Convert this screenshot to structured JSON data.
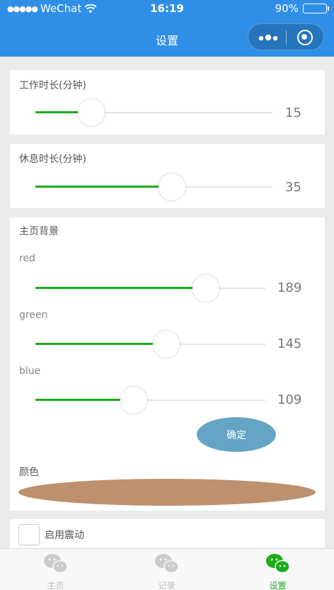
{
  "status_bar": {
    "carrier": "WeChat",
    "signal_dots": "●●●●●",
    "time": "16:19",
    "battery": "90%"
  },
  "nav": {
    "title": "设置"
  },
  "work": {
    "label": "工作时长(分钟)",
    "value": 15,
    "min": 1,
    "max": 60
  },
  "rest": {
    "label": "休息时长(分钟)",
    "value": 35,
    "min": 1,
    "max": 60
  },
  "background": {
    "label": "主页背景",
    "red": {
      "label": "red",
      "value": 189,
      "min": 0,
      "max": 255
    },
    "green": {
      "label": "green",
      "value": 145,
      "min": 0,
      "max": 255
    },
    "blue": {
      "label": "blue",
      "value": 109,
      "min": 0,
      "max": 255
    },
    "confirm_label": "确定",
    "color_label": "颜色",
    "swatch_color": "#bd916d"
  },
  "vibration": {
    "label": "启用震动",
    "checked": false
  },
  "tabs": [
    {
      "label": "主页",
      "icon": "wechat-icon",
      "active": false
    },
    {
      "label": "记录",
      "icon": "wechat-icon",
      "active": false
    },
    {
      "label": "设置",
      "icon": "wechat-icon",
      "active": true
    }
  ],
  "colors": {
    "nav_blue": "#2f8fe6",
    "slider_active": "#1aad19",
    "confirm_button": "#65a4c4",
    "tab_active": "#1aad19",
    "tab_inactive": "#bbbbbb"
  }
}
